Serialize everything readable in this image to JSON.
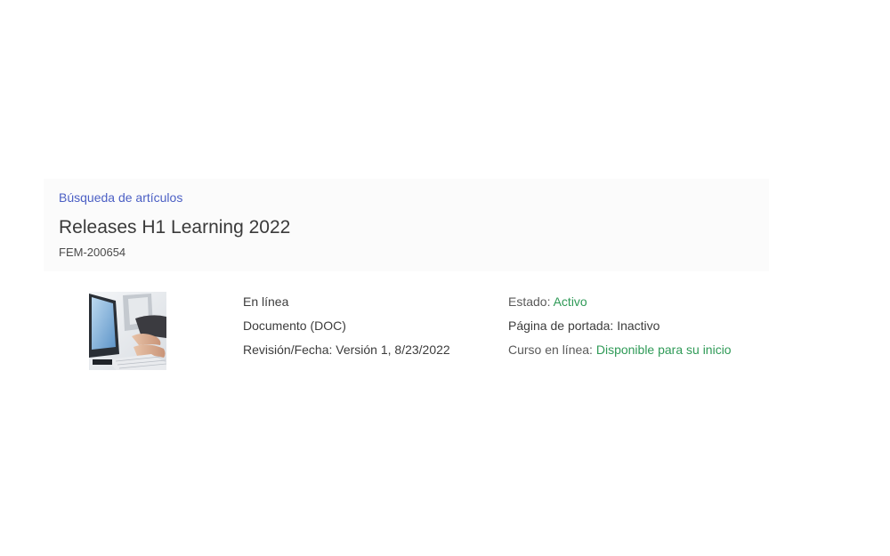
{
  "header": {
    "breadcrumb": "Búsqueda de artículos",
    "title": "Releases H1 Learning 2022",
    "item_id": "FEM-200654"
  },
  "thumbnail": {
    "icon": "computer-keyboard-photo"
  },
  "details_left": {
    "delivery": "En línea",
    "type": "Documento (DOC)",
    "revision": "Revisión/Fecha: Versión 1, 8/23/2022"
  },
  "details_right": {
    "status_label": "Estado: ",
    "status_value": "Activo",
    "cover_page": "Página de portada: Inactivo",
    "online_course_label": "Curso en línea: ",
    "online_course_value": "Disponible para su inicio"
  },
  "colors": {
    "link": "#4b5fc4",
    "status_green": "#2f9a57"
  }
}
